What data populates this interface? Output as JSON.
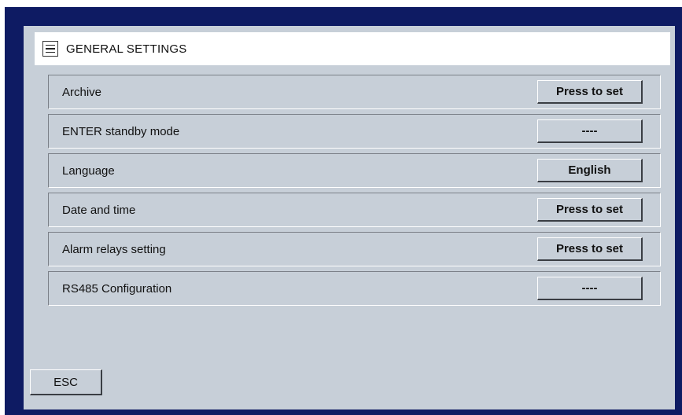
{
  "header": {
    "title": "GENERAL SETTINGS",
    "icon": "menu-list-icon"
  },
  "settings": [
    {
      "label": "Archive",
      "button": "Press to set"
    },
    {
      "label": "ENTER standby mode",
      "button": "----"
    },
    {
      "label": "Language",
      "button": "English"
    },
    {
      "label": "Date and time",
      "button": "Press to set"
    },
    {
      "label": "Alarm relays setting",
      "button": "Press to set"
    },
    {
      "label": "RS485 Configuration",
      "button": "----"
    }
  ],
  "footer": {
    "esc_label": "ESC"
  },
  "colors": {
    "frame": "#0e1b63",
    "panel": "#c7cfd8",
    "header": "#ffffff"
  }
}
